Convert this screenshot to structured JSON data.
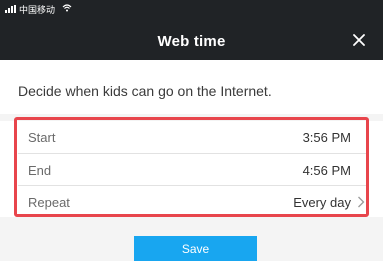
{
  "status_bar": {
    "carrier": "中国移动",
    "wifi_icon": "wifi-icon"
  },
  "header": {
    "title": "Web time",
    "close_icon": "close-icon"
  },
  "description": {
    "text": "Decide when kids can go on the Internet."
  },
  "settings": {
    "rows": [
      {
        "label": "Start",
        "value": "3:56 PM"
      },
      {
        "label": "End",
        "value": "4:56 PM"
      },
      {
        "label": "Repeat",
        "value": "Every day",
        "icon": "chevron-right-icon"
      }
    ]
  },
  "actions": {
    "save_label": "Save"
  },
  "colors": {
    "header_bg": "#202326",
    "highlight": "#e8454c",
    "save_button": "#18a6f0"
  }
}
